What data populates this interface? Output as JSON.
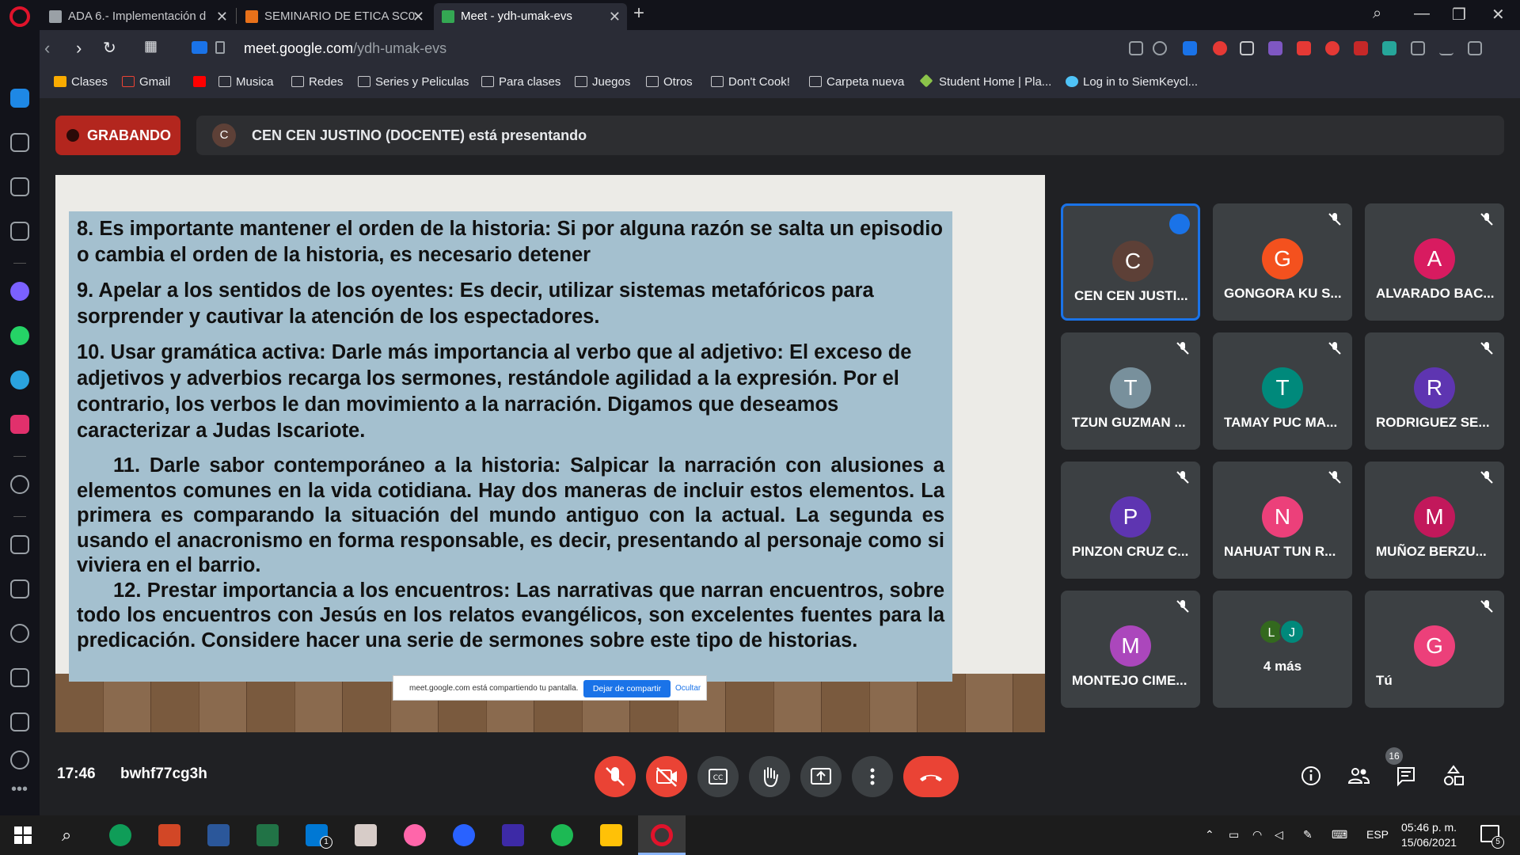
{
  "browser": {
    "tabs": [
      {
        "title": "ADA 6.- Implementación d",
        "color": "#9aa0a6"
      },
      {
        "title": "SEMINARIO DE ETICA SC0",
        "color": "#e8711a"
      },
      {
        "title": "Meet - ydh-umak-evs",
        "color": "#34a853"
      }
    ],
    "new_tab": "+",
    "url_domain": "meet.google.com",
    "url_path": "/ydh-umak-evs",
    "bookmarks": [
      "Clases",
      "Gmail",
      "Musica",
      "Redes",
      "Series y Peliculas",
      "Para clases",
      "Juegos",
      "Otros",
      "Don't Cook!",
      "Carpeta nueva",
      "Student Home | Pla...",
      "Log in to SiemKeycl..."
    ]
  },
  "meet": {
    "recording_label": "GRABANDO",
    "presenter_initial": "C",
    "presenting_text": "CEN CEN JUSTINO (DOCENTE) está presentando",
    "time": "17:46",
    "meeting_code": "bwhf77cg3h",
    "participant_count": "16",
    "participants": [
      {
        "name": "CEN CEN JUSTI...",
        "initial": "C",
        "color": "#5d4037"
      },
      {
        "name": "GONGORA KU S...",
        "initial": "G",
        "color": "#f4511e"
      },
      {
        "name": "ALVARADO BAC...",
        "initial": "A",
        "color": "#d81b60"
      },
      {
        "name": "TZUN GUZMAN ...",
        "initial": "T",
        "color": "#78909c"
      },
      {
        "name": "TAMAY PUC MA...",
        "initial": "T",
        "color": "#00897b"
      },
      {
        "name": "RODRIGUEZ SE...",
        "initial": "R",
        "color": "#5e35b1"
      },
      {
        "name": "PINZON CRUZ C...",
        "initial": "P",
        "color": "#5e35b1"
      },
      {
        "name": "NAHUAT TUN R...",
        "initial": "N",
        "color": "#ec407a"
      },
      {
        "name": "MUÑOZ BERZU...",
        "initial": "M",
        "color": "#c2185b"
      },
      {
        "name": "MONTEJO CIME...",
        "initial": "M",
        "color": "#ab47bc"
      },
      {
        "name": "4 más",
        "initial": "L",
        "initial2": "J",
        "color": "#33691e",
        "color2": "#00897b"
      },
      {
        "name": "Tú",
        "initial": "G",
        "color": "#ec407a"
      }
    ],
    "share_notice": "meet.google.com está compartiendo tu pantalla.",
    "stop_share": "Dejar de compartir",
    "hide": "Ocultar"
  },
  "slide": {
    "p8": "8. Es importante mantener el orden de la historia: Si por alguna razón se salta un episodio o cambia el orden de la historia, es necesario detener",
    "p9": "9. Apelar a los sentidos de los oyentes: Es decir, utilizar sistemas metafóricos para sorprender y cautivar la atención de los espectadores.",
    "p10": "10. Usar gramática activa: Darle más importancia al verbo que al adjetivo: El exceso de adjetivos y adverbios recarga los sermones, restándole agilidad a la expresión. Por el contrario, los verbos le dan movimiento a la narración. Digamos que deseamos caracterizar a Judas Iscariote.",
    "p11": "11. Darle sabor contemporáneo a la historia: Salpicar la narración con alusiones a elementos comunes en la vida cotidiana. Hay dos maneras de incluir estos elementos. La primera es comparando la situación del mundo antiguo con la actual. La segunda es usando el anacronismo en forma responsable, es decir, presentando al personaje como si viviera en el barrio.",
    "p12": "12. Prestar importancia a los encuentros: Las narrativas que narran encuentros, sobre todo los encuentros con Jesús en los relatos evangélicos, son excelentes fuentes para la predicación. Considere hacer una serie de sermones sobre este tipo de historias."
  },
  "taskbar": {
    "lang": "ESP",
    "clock_time": "05:46 p. m.",
    "clock_date": "15/06/2021",
    "notif_count": "5",
    "word_badge": "1"
  }
}
